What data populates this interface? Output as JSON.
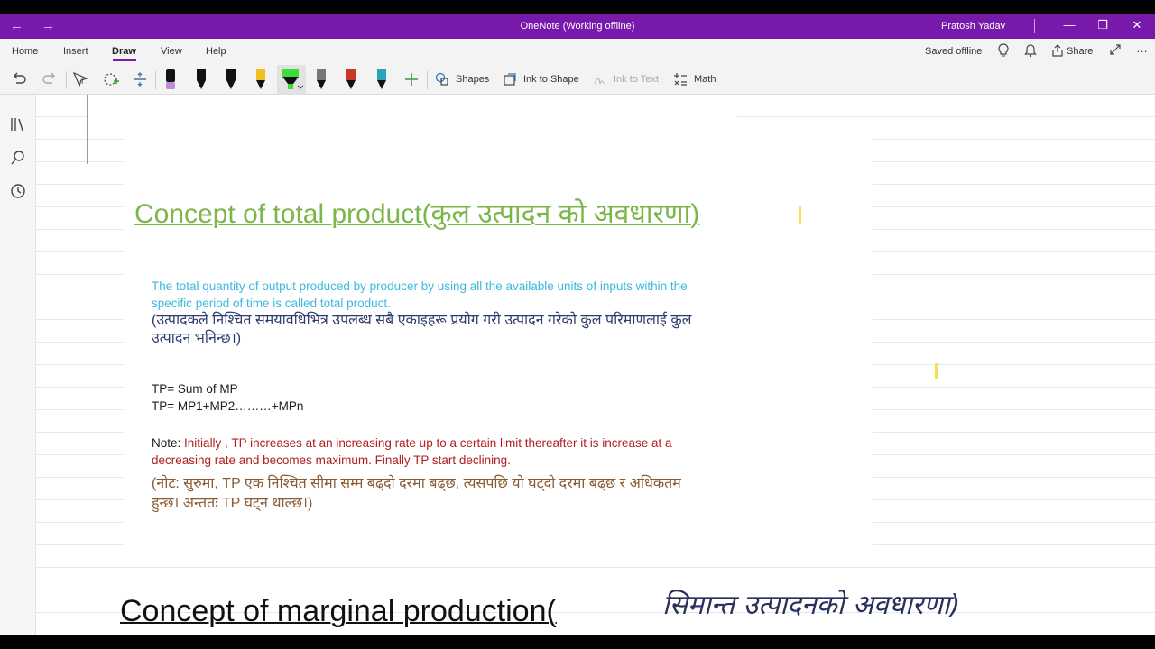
{
  "window": {
    "title": "OneNote (Working offline)",
    "user": "Pratosh Yadav"
  },
  "menu": {
    "tabs": [
      "Home",
      "Insert",
      "Draw",
      "View",
      "Help"
    ],
    "saved_status": "Saved offline",
    "share_label": "Share"
  },
  "ribbon": {
    "shapes_label": "Shapes",
    "ink_to_shape_label": "Ink to Shape",
    "ink_to_text_label": "Ink to Text",
    "math_label": "Math",
    "pens": [
      {
        "name": "pen-black-purple",
        "color": "#c28bd6"
      },
      {
        "name": "pen-black-1",
        "color": "#111111"
      },
      {
        "name": "pen-black-2",
        "color": "#111111"
      },
      {
        "name": "pen-yellow",
        "color": "#f0c020"
      },
      {
        "name": "highlighter-green",
        "color": "#3ddc3d"
      },
      {
        "name": "pen-gray",
        "color": "#777777"
      },
      {
        "name": "pen-red",
        "color": "#c8382a"
      },
      {
        "name": "pen-teal",
        "color": "#2aa4b8"
      }
    ]
  },
  "page": {
    "heading": "Concept of total product(कुल उत्पादन को अवधारणा)",
    "definition_en": "The total quantity of output produced by producer by using all the available units of inputs within the specific period of time is called total product.",
    "definition_np": "(उत्पादकले निश्चित समयावधिभित्र उपलब्ध सबै एकाइहरू प्रयोग गरी उत्पादन गरेको कुल परिमाणलाई कुल उत्पादन भनिन्छ।)",
    "formula1": "TP= Sum of MP",
    "formula2": "TP= MP1+MP2………+MPn",
    "note_label": "Note:",
    "note_text": "Initially , TP increases at an increasing rate up to a certain limit thereafter it is increase at a decreasing rate and becomes maximum. Finally TP start declining.",
    "note_np": "(नोट: सुरुमा, TP एक निश्चित सीमा सम्म बढ्दो दरमा बढ्छ, त्यसपछि यो  घट्दो  दरमा बढ्छ र अधिकतम हुन्छ। अन्ततः TP घट्न थाल्छ।)",
    "heading2": "Concept of marginal production(",
    "handwritten": "सिमान्त उत्पादनको अवधारणा)"
  },
  "colors": {
    "titlebar": "#7719aa",
    "heading": "#7ab648",
    "definition_en": "#3cb8e0",
    "note_red": "#b02020"
  }
}
